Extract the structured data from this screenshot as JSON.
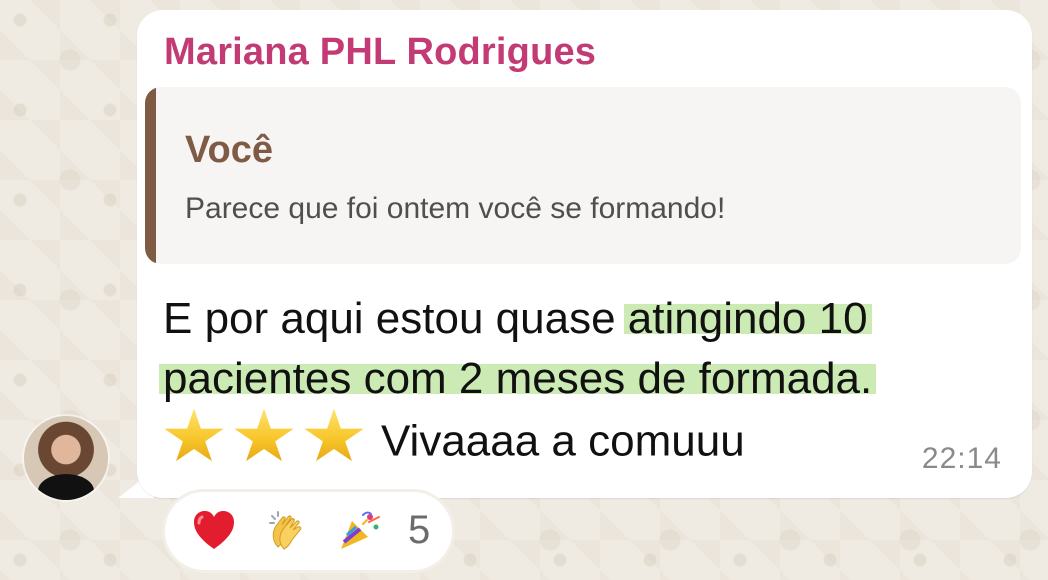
{
  "chat": {
    "sender": "Mariana PHL Rodrigues",
    "quote": {
      "author": "Você",
      "text": "Parece que foi ontem você se formando!"
    },
    "message": {
      "line1_prefix": "E por aqui estou quase ",
      "line1_highlight": "atingindo 10",
      "line2_highlight": "pacientes com 2 meses de formada.",
      "line3_text": "Vivaaaa a comuuu"
    },
    "timestamp": "22:14",
    "reactions": {
      "count": "5",
      "icons": [
        "heart-icon",
        "clapping-hands-icon",
        "party-popper-icon"
      ]
    },
    "colors": {
      "sender": "#c33b74",
      "quote_accent": "#7f5a45",
      "highlight": "#ccebb4"
    }
  }
}
